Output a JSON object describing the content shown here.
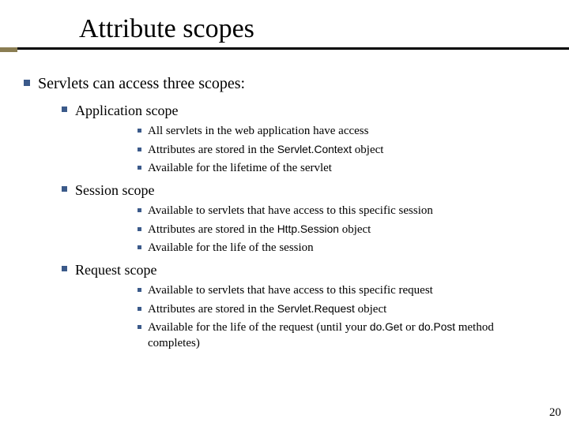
{
  "title": "Attribute scopes",
  "lvl1_text": "Servlets can access three scopes:",
  "scopes": [
    {
      "heading": "Application scope",
      "points": [
        {
          "pre": "All servlets in the web application have access",
          "code": "",
          "post": ""
        },
        {
          "pre": "Attributes are stored in the ",
          "code": "Servlet.Context",
          "post": " object"
        },
        {
          "pre": "Available for the lifetime of the servlet",
          "code": "",
          "post": ""
        }
      ]
    },
    {
      "heading": "Session scope",
      "points": [
        {
          "pre": "Available to servlets that have access to this specific session",
          "code": "",
          "post": ""
        },
        {
          "pre": "Attributes are stored in the ",
          "code": "Http.Session",
          "post": " object"
        },
        {
          "pre": "Available for the life of the session",
          "code": "",
          "post": ""
        }
      ]
    },
    {
      "heading": "Request scope",
      "points": [
        {
          "pre": "Available to servlets that have access to this specific request",
          "code": "",
          "post": ""
        },
        {
          "pre": "Attributes are stored in the ",
          "code": "Servlet.Request",
          "post": " object"
        },
        {
          "pre": "Available for the life of the request (until your ",
          "code": "do.Get",
          "post_mid": " or ",
          "code2": "do.Post",
          "post": " method completes)"
        }
      ]
    }
  ],
  "page_number": "20"
}
